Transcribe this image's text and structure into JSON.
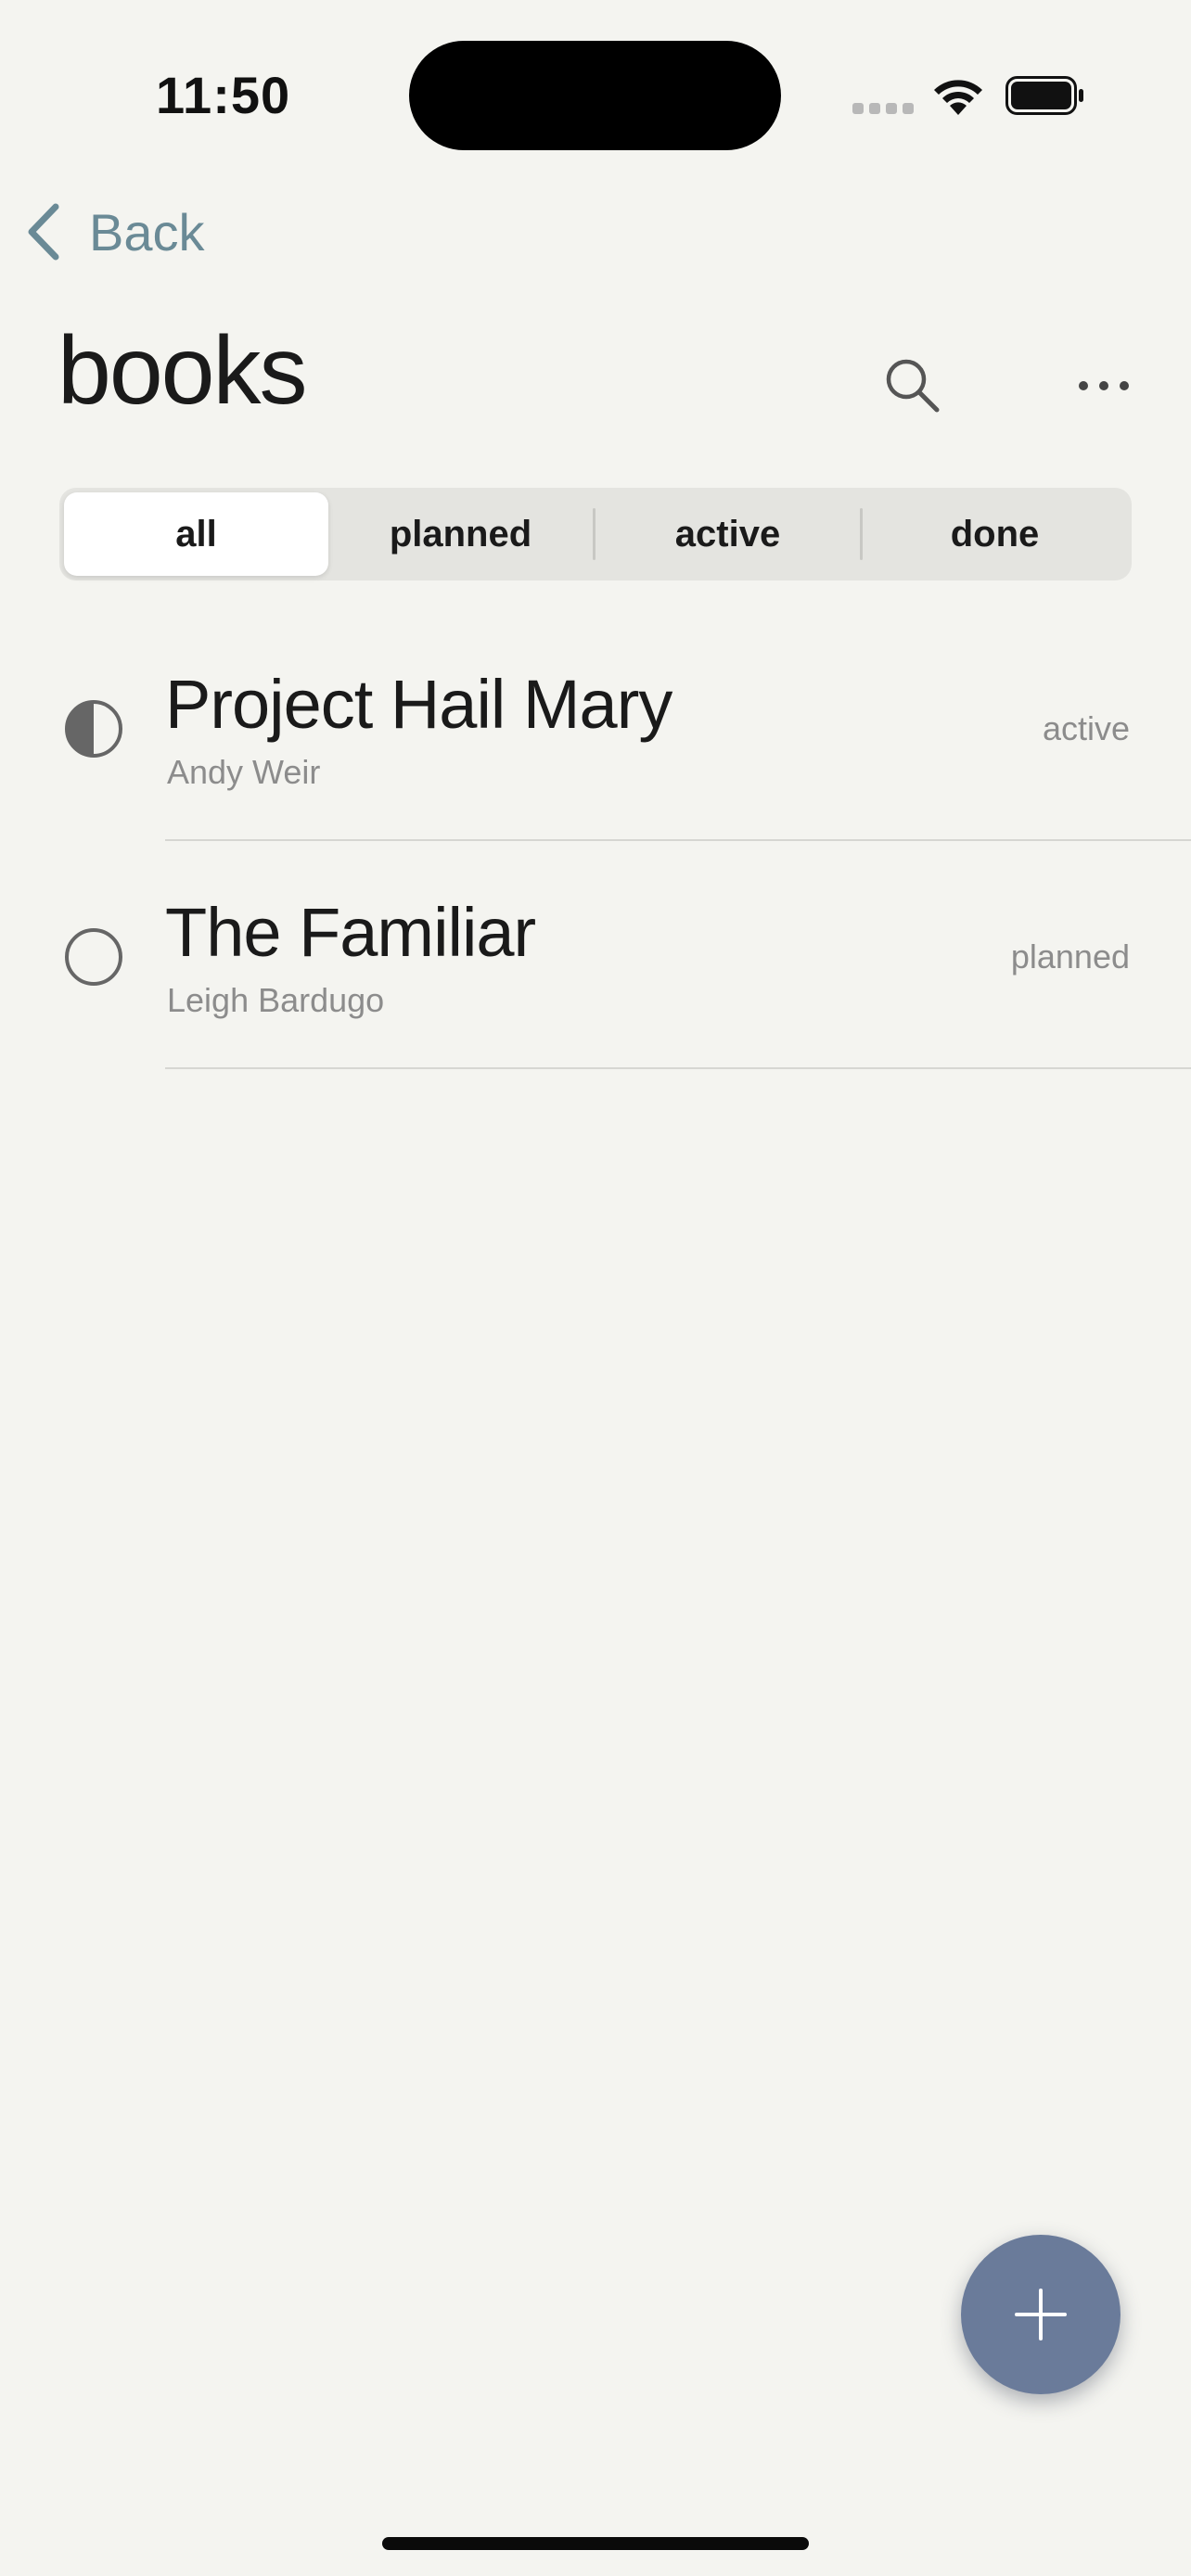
{
  "status_bar": {
    "time": "11:50"
  },
  "nav": {
    "back_label": "Back",
    "title": "books"
  },
  "filter": {
    "segments": [
      "all",
      "planned",
      "active",
      "done"
    ],
    "selected": "all"
  },
  "books": [
    {
      "title": "Project Hail Mary",
      "author": "Andy Weir",
      "status": "active",
      "icon": "half-filled-circle-icon"
    },
    {
      "title": "The Familiar",
      "author": "Leigh Bardugo",
      "status": "planned",
      "icon": "empty-circle-icon"
    }
  ],
  "colors": {
    "background": "#F4F4F0",
    "accent_back": "#6a8a96",
    "fab": "#6A7B9A",
    "secondary_text": "#8c8c8c"
  },
  "icons": {
    "search": "search-icon",
    "more": "more-icon",
    "add": "plus-icon",
    "back": "chevron-left-icon"
  }
}
